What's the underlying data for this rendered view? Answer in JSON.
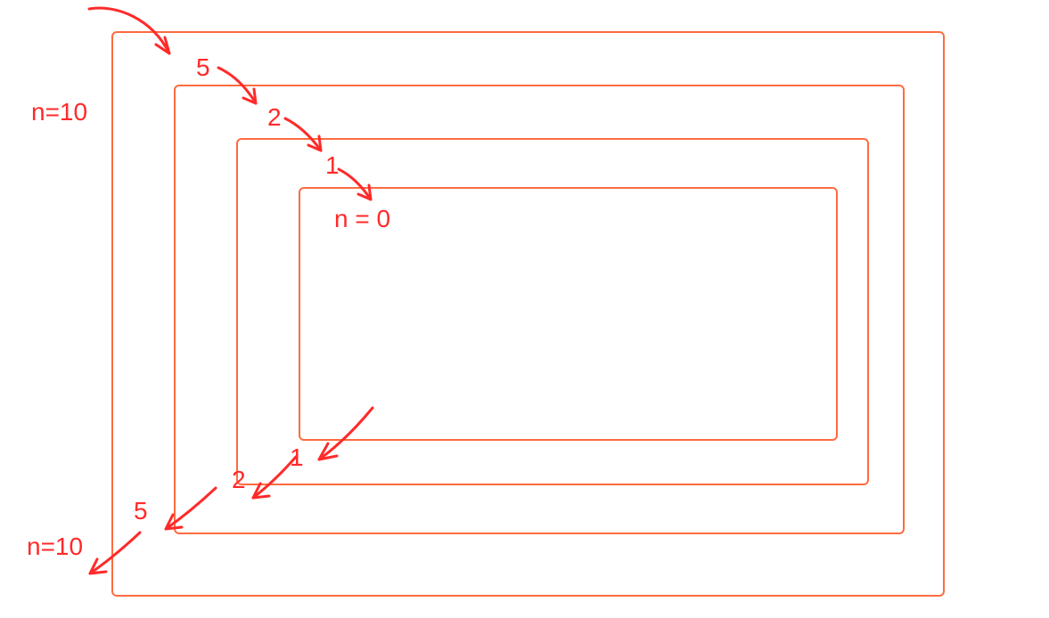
{
  "diagram": {
    "labels": {
      "outer_left_top": "n=10",
      "outer_left_bottom": "n=10",
      "inward_1": "5",
      "inward_2": "2",
      "inward_3": "1",
      "base_case": "n = 0",
      "outward_1": "1",
      "outward_2": "2",
      "outward_3": "5"
    },
    "sequence_inward": [
      10,
      5,
      2,
      1,
      0
    ],
    "sequence_outward": [
      0,
      1,
      2,
      5,
      10
    ]
  }
}
